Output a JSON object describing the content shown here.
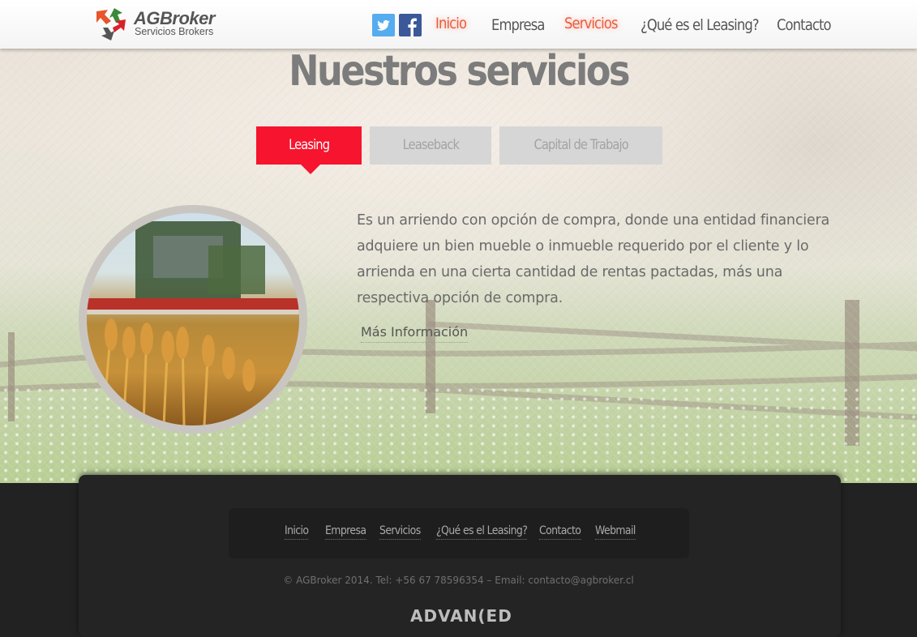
{
  "header": {
    "brand": "AGBroker",
    "tagline": "Servicios Brokers",
    "social": [
      {
        "name": "twitter-icon",
        "glyph": "t"
      },
      {
        "name": "facebook-icon",
        "glyph": "f"
      }
    ],
    "nav": [
      {
        "label": "Inicio",
        "highlight": true
      },
      {
        "label": "Empresa",
        "highlight": false
      },
      {
        "label": "Servicios",
        "highlight": true
      },
      {
        "label": "¿Qué es el Leasing?",
        "highlight": false
      },
      {
        "label": "Contacto",
        "highlight": false
      }
    ]
  },
  "main": {
    "title": "Nuestros servicios",
    "tabs": [
      {
        "label": "Leasing",
        "active": true
      },
      {
        "label": "Leaseback",
        "active": false
      },
      {
        "label": "Capital de Trabajo",
        "active": false
      }
    ],
    "description": "Es un arriendo con opción de compra, donde una entidad financiera adquiere un bien mueble o inmueble requerido por el cliente y lo arrienda en una cierta cantidad de rentas pactadas, más una respectiva opción de compra.",
    "more_link": "Más Información"
  },
  "footer": {
    "links": [
      "Inicio",
      "Empresa",
      "Servicios",
      "¿Qué es el Leasing?",
      "Contacto",
      "Webmail"
    ],
    "copyright": "© AGBroker 2014. Tel: +56 67 78596354 – Email: contacto@agbroker.cl",
    "credit": "ADVAN(ED"
  },
  "colors": {
    "accent_red": "#f6142e",
    "nav_highlight": "#ee5a3a",
    "twitter": "#55acee",
    "facebook": "#3b5998"
  }
}
